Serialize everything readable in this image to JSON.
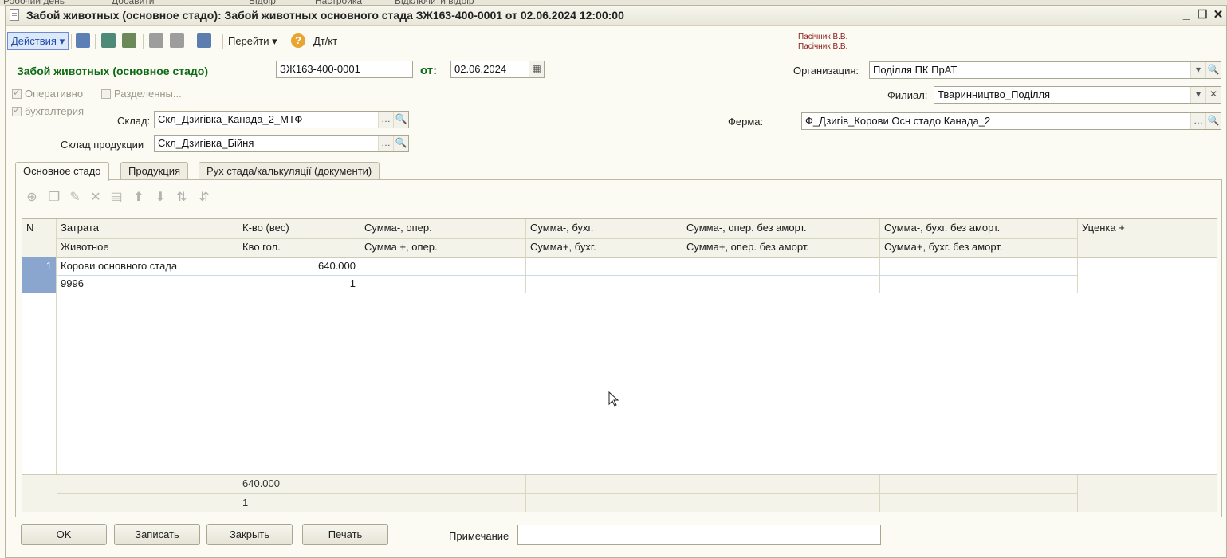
{
  "background": {
    "items": [
      "Робочий день",
      "Добавити",
      "Відбір",
      "Настройка",
      "Відключити відбір"
    ]
  },
  "window": {
    "title": "Забой животных (основное стадо): Забой животных основного стада ЗЖ163-400-0001 от 02.06.2024 12:00:00"
  },
  "toolbar": {
    "actions_label": "Действия",
    "goto_label": "Перейти",
    "dtkt_label": "Дт/кт"
  },
  "user": {
    "line1": "Пасічник В.В.",
    "line2": "Пасічник В.В."
  },
  "header": {
    "doc_type": "Забой животных (основное стадо)",
    "number": "ЗЖ163-400-0001",
    "from_label": "от:",
    "date": "02.06.2024",
    "org_label": "Организация:",
    "org_value": "Поділля ПК ПрАТ",
    "branch_label": "Филиал:",
    "branch_value": "Тваринництво_Поділля",
    "farm_label": "Ферма:",
    "farm_value": "Ф_Дзигів_Корови Осн стадо Канада_2",
    "warehouse_label": "Склад:",
    "warehouse_value": "Скл_Дзигівка_Канада_2_МТФ",
    "product_wh_label": "Склад продукции",
    "product_wh_value": "Скл_Дзигівка_Бійня",
    "chk_operative": "Оперативно",
    "chk_split": "Разделенны...",
    "chk_accounting": "бухгалтерия"
  },
  "tabs": [
    {
      "label": "Основное стадо"
    },
    {
      "label": "Продукция"
    },
    {
      "label": "Рух стада/калькуляції (документи)"
    }
  ],
  "grid": {
    "headers_top": [
      "N",
      "Затрата",
      "К-во (вес)",
      "Сумма-, опер.",
      "Сумма-, бухг.",
      "Сумма-, опер. без аморт.",
      "Сумма-, бухг. без аморт.",
      "Уценка +"
    ],
    "headers_bottom": [
      "Животное",
      "Кво гол.",
      "Сумма +, опер.",
      "Сумма+, бухг.",
      "Сумма+, опер. без аморт.",
      "Сумма+, бухг. без аморт."
    ],
    "rows": [
      {
        "n": "1",
        "cost": "Корови основного стада",
        "qty": "640.000",
        "animal": "9996",
        "heads": "1"
      }
    ],
    "totals": {
      "qty": "640.000",
      "heads": "1"
    }
  },
  "buttons": {
    "ok": "OK",
    "save": "Записать",
    "close": "Закрыть",
    "print": "Печать"
  },
  "note": {
    "label": "Примечание",
    "value": ""
  }
}
